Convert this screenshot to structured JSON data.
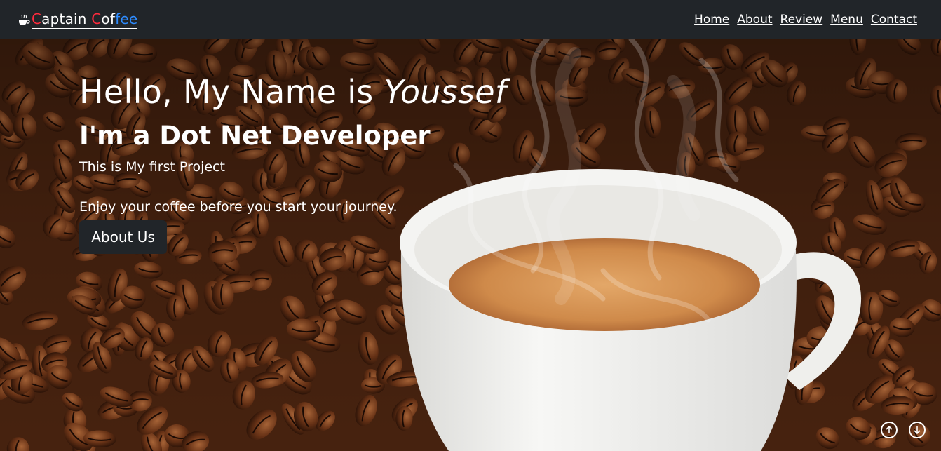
{
  "nav": {
    "brand": {
      "part1": "C",
      "part2": "aptain ",
      "part3": "C",
      "part4": "of",
      "part5": "fee"
    },
    "links": [
      "Home",
      "About",
      "Review",
      "Menu",
      "Contact"
    ]
  },
  "hero": {
    "greeting": "Hello, My Name is ",
    "name": "Youssef",
    "role": "I'm a Dot Net Developer",
    "subtitle": "This is My first Project",
    "tagline": "Enjoy your coffee before you start your journey.",
    "button": "About Us"
  },
  "colors": {
    "nav_bg": "#212529",
    "brand_red": "#ff2b3d",
    "brand_blue": "#2e8cff",
    "button_bg": "#212529"
  },
  "icons": {
    "brand": "coffee-cup-icon",
    "scroll_up": "arrow-up-circle-icon",
    "scroll_down": "arrow-down-circle-icon"
  }
}
